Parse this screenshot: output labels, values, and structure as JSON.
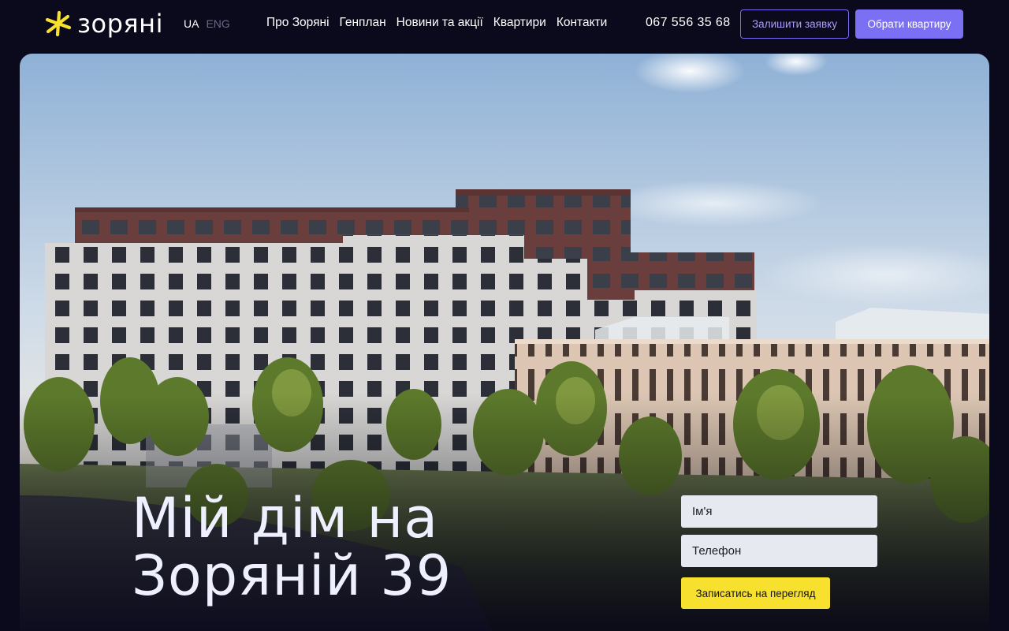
{
  "brand": {
    "name": "зоряні",
    "accent": "#7b6ff4",
    "logo_color": "#f7e12e"
  },
  "lang": {
    "active": "UA",
    "inactive": "ENG"
  },
  "nav": {
    "items": [
      {
        "label": "Про Зоряні"
      },
      {
        "label": "Генплан"
      },
      {
        "label": "Новини та акції"
      },
      {
        "label": "Квартири"
      },
      {
        "label": "Контакти"
      }
    ]
  },
  "header": {
    "phone": "067 556 35 68",
    "leave_request_label": "Залишити заявку",
    "choose_apartment_label": "Обрати квартиру"
  },
  "hero": {
    "title_line1": "Мій дім на",
    "title_line2": "Зоряній 39"
  },
  "form": {
    "name_placeholder": "Ім'я",
    "phone_placeholder": "Телефон",
    "submit_label": "Записатись на перегляд",
    "submit_color": "#f7e12e"
  }
}
